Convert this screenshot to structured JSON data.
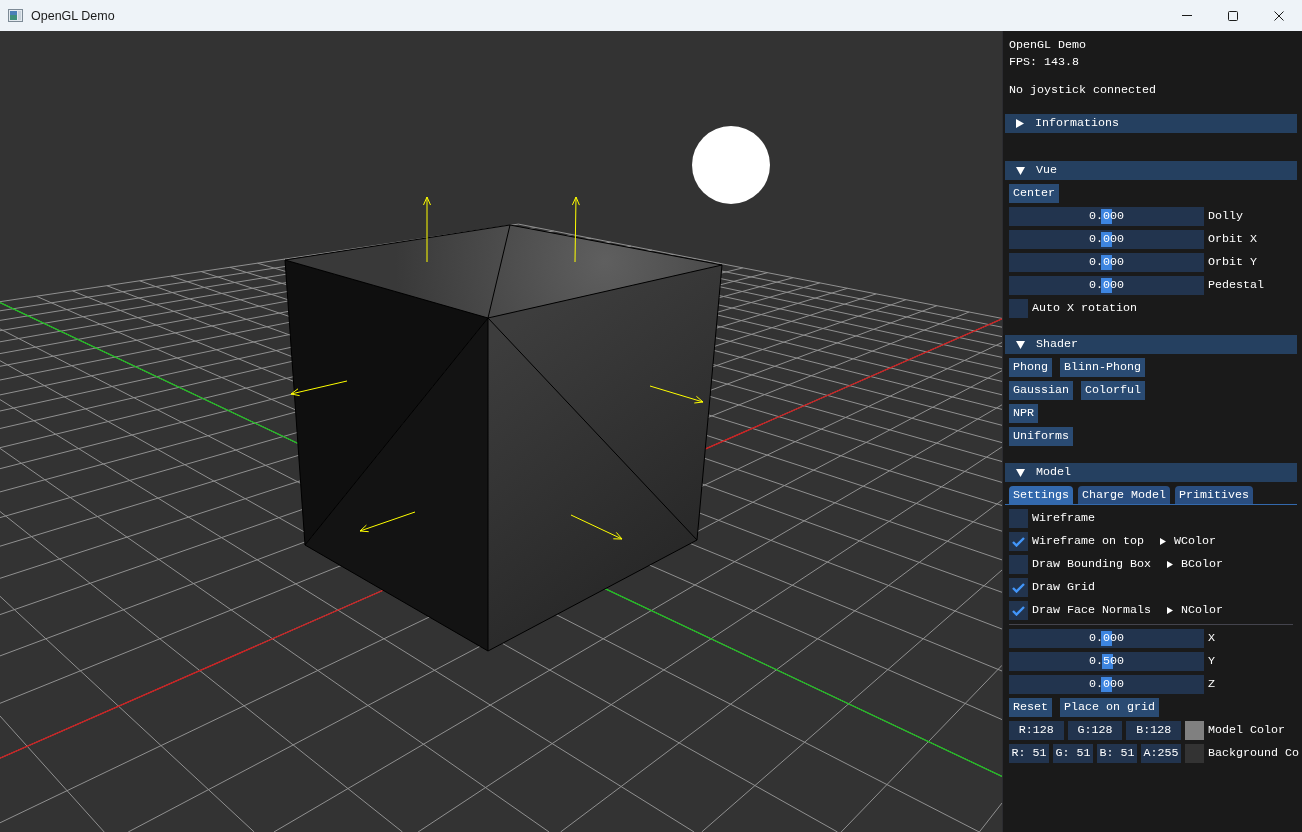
{
  "window": {
    "title": "OpenGL Demo"
  },
  "panel": {
    "title": "OpenGL Demo",
    "fps": "FPS: 143.8",
    "joystick": "No joystick connected",
    "sections": [
      {
        "label": "Informations",
        "expanded": false
      },
      {
        "label": "Vue",
        "expanded": true,
        "items": [
          {
            "kind": "buttons",
            "buttons": [
              "Center"
            ]
          },
          {
            "kind": "slider",
            "reading": "0.000",
            "level": 0.5,
            "label": "Dolly"
          },
          {
            "kind": "slider",
            "reading": "0.000",
            "level": 0.5,
            "label": "Orbit X"
          },
          {
            "kind": "slider",
            "reading": "0.000",
            "level": 0.5,
            "label": "Orbit Y"
          },
          {
            "kind": "slider",
            "reading": "0.000",
            "level": 0.5,
            "label": "Pedestal"
          },
          {
            "kind": "checkbox",
            "label": "Auto X rotation",
            "checked": false
          }
        ]
      },
      {
        "label": "Shader",
        "expanded": true,
        "items": [
          {
            "kind": "buttons",
            "buttons": [
              "Phong",
              "Blinn-Phong"
            ]
          },
          {
            "kind": "buttons",
            "buttons": [
              "Gaussian",
              "Colorful"
            ]
          },
          {
            "kind": "buttons",
            "buttons": [
              "NPR"
            ]
          },
          {
            "kind": "buttons",
            "buttons": [
              "Uniforms"
            ]
          }
        ]
      },
      {
        "label": "Model",
        "expanded": true,
        "items": [
          {
            "kind": "tabs",
            "tabs": [
              {
                "label": "Settings",
                "selected": true
              },
              {
                "label": "Charge Model",
                "selected": false
              },
              {
                "label": "Primitives",
                "selected": false
              }
            ]
          },
          {
            "kind": "checkbox",
            "label": "Wireframe",
            "checked": false
          },
          {
            "kind": "checkbox",
            "label": "Wireframe on top",
            "checked": true,
            "node": {
              "label": "WColor",
              "expanded": false
            }
          },
          {
            "kind": "checkbox",
            "label": "Draw Bounding Box",
            "checked": false,
            "node": {
              "label": "BColor",
              "expanded": false
            }
          },
          {
            "kind": "checkbox",
            "label": "Draw Grid",
            "checked": true
          },
          {
            "kind": "checkbox",
            "label": "Draw Face Normals",
            "checked": true,
            "node": {
              "label": "NColor",
              "expanded": false
            }
          },
          {
            "kind": "separator"
          },
          {
            "kind": "slider",
            "reading": "0.000",
            "level": 0.5,
            "label": "X"
          },
          {
            "kind": "slider",
            "reading": "0.500",
            "level": 0.505,
            "label": "Y"
          },
          {
            "kind": "slider",
            "reading": "0.000",
            "level": 0.5,
            "label": "Z"
          },
          {
            "kind": "buttons",
            "buttons": [
              "Reset",
              "Place on grid"
            ]
          },
          {
            "kind": "color",
            "fields": [
              "R:128",
              "G:128",
              "B:128"
            ],
            "color": "#808080",
            "label": "Model Color"
          },
          {
            "kind": "color",
            "fields": [
              "R: 51",
              "G: 51",
              "B: 51",
              "A:255"
            ],
            "color": "#333333",
            "label": "Background Co"
          }
        ]
      }
    ]
  }
}
